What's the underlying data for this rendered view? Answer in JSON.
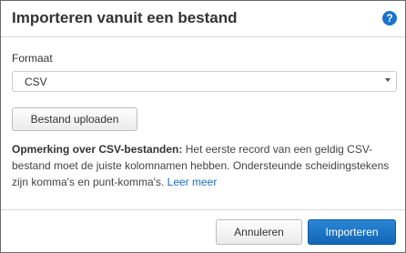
{
  "dialog": {
    "title": "Importeren vanuit een bestand",
    "help_icon_glyph": "?"
  },
  "form": {
    "format_label": "Formaat",
    "format_value": "CSV",
    "upload_label": "Bestand uploaden"
  },
  "note": {
    "bold": "Opmerking over CSV-bestanden:",
    "text": " Het eerste record van een geldig CSV-bestand moet de juiste kolomnamen hebben. Ondersteunde scheidingstekens zijn komma's en punt-komma's. ",
    "link": "Leer meer"
  },
  "footer": {
    "cancel_label": "Annuleren",
    "import_label": "Importeren"
  },
  "colors": {
    "accent": "#1a73c9",
    "primary_button": "#1266b5",
    "link": "#1a6fc4"
  },
  "icons": [
    "help-icon",
    "caret-down-icon"
  ]
}
